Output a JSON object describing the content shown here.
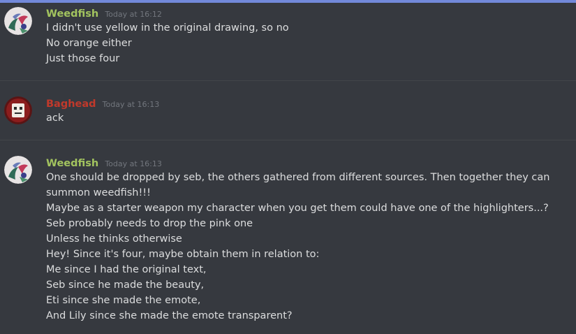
{
  "colors": {
    "background": "#36393f",
    "accent_bar": "#7289da",
    "text": "#dcddde",
    "timestamp": "#72767d",
    "weedfish_name": "#a3c45f",
    "baghead_name": "#c0392b"
  },
  "messages": [
    {
      "username": "Weedfish",
      "timestamp": "Today at 16:12",
      "avatar_icon": "weedfish-avatar",
      "lines": [
        "I didn't use yellow in the original drawing, so no",
        "No orange either",
        "Just those four"
      ]
    },
    {
      "username": "Baghead",
      "timestamp": "Today at 16:13",
      "avatar_icon": "baghead-avatar",
      "lines": [
        "ack"
      ]
    },
    {
      "username": "Weedfish",
      "timestamp": "Today at 16:13",
      "avatar_icon": "weedfish-avatar",
      "lines": [
        "One should be dropped by seb, the others gathered from different sources. Then together they can summon weedfish!!!",
        "Maybe as a starter weapon my character when you get them could have one of the highlighters...?",
        "Seb probably needs to drop the pink one",
        "Unless he thinks otherwise",
        "Hey! Since it's four, maybe obtain them in relation to:",
        "Me since I had the original text,",
        "Seb since he made the beauty,",
        "Eti since she made the emote,",
        "And Lily since she made the emote transparent?"
      ]
    }
  ]
}
